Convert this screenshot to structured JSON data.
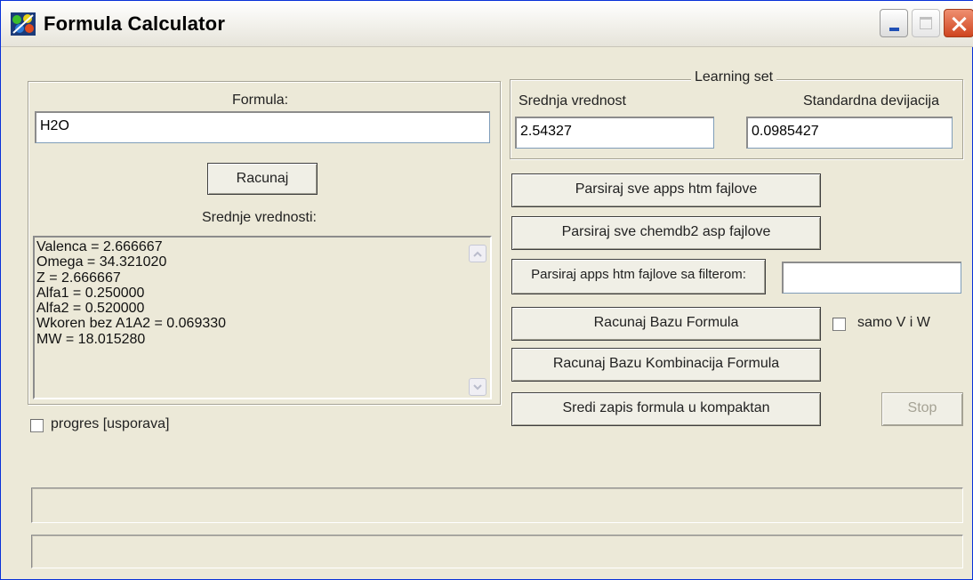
{
  "window": {
    "title": "Formula Calculator"
  },
  "formula": {
    "label": "Formula:",
    "value": "H2O",
    "calculate_button": "Racunaj",
    "averages_label": "Srednje vrednosti:",
    "results": [
      "Valenca = 2.666667",
      "Omega = 34.321020",
      "Z = 2.666667",
      "Alfa1 = 0.250000",
      "Alfa2 = 0.520000",
      "Wkoren bez A1A2 = 0.069330",
      "MW = 18.015280"
    ],
    "progress_checkbox_label": "progres [usporava]"
  },
  "learning_set": {
    "legend": "Learning set",
    "mean_label": "Srednja vrednost",
    "mean_value": "2.54327",
    "stddev_label": "Standardna devijacija",
    "stddev_value": "0.0985427"
  },
  "actions": {
    "parse_apps": "Parsiraj sve apps htm fajlove",
    "parse_chemdb2": "Parsiraj sve chemdb2 asp fajlove",
    "parse_filter": "Parsiraj apps htm fajlove sa filterom:",
    "filter_value": "",
    "calc_db": "Racunaj Bazu Formula",
    "only_vw_label": "samo V i W",
    "calc_combinations": "Racunaj Bazu Kombinacija Formula",
    "compact_notation": "Sredi zapis formula u kompaktan",
    "stop": "Stop"
  },
  "colors": {
    "window_bg": "#ece9d8",
    "title_bar": "#f4f3ee",
    "close_button": "#cf4520"
  }
}
